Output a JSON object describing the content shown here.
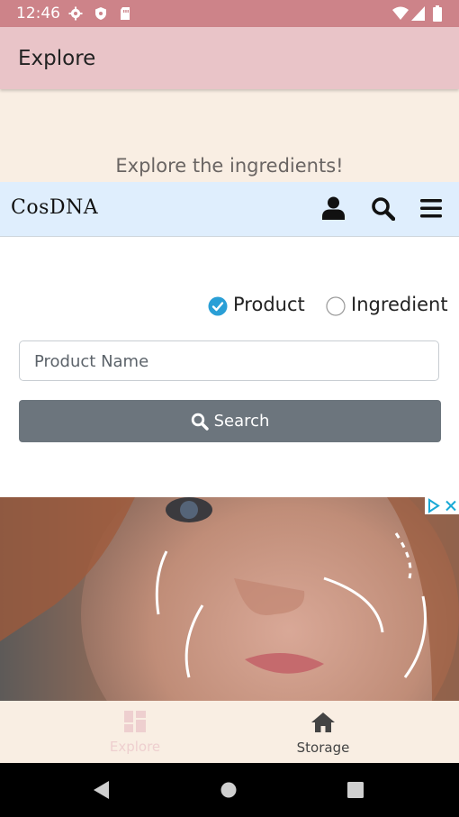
{
  "status_bar": {
    "time": "12:46"
  },
  "app_bar": {
    "title": "Explore"
  },
  "page": {
    "subtitle": "Explore the ingredients!"
  },
  "web": {
    "logo_text": "CosDNA",
    "search_type": {
      "options": [
        "Product",
        "Ingredient"
      ],
      "selected": "Product"
    },
    "search_input": {
      "placeholder": "Product Name"
    },
    "search_button": {
      "label": "Search"
    }
  },
  "ad": {
    "choices_icon": "adchoices-icon",
    "close_icon": "close-icon"
  },
  "bottom_nav": {
    "items": [
      {
        "label": "Explore",
        "icon": "dashboard-icon",
        "active": true
      },
      {
        "label": "Storage",
        "icon": "home-icon",
        "active": false
      }
    ]
  },
  "colors": {
    "status_bar": "#cd8389",
    "app_bar": "#e9c4c8",
    "background": "#f9eee3",
    "web_header": "#dfeefd",
    "button": "#6c757d",
    "radio_checked": "#2a9fd6",
    "nav_inactive": "#eecfcf",
    "nav_active_text": "#444444"
  }
}
